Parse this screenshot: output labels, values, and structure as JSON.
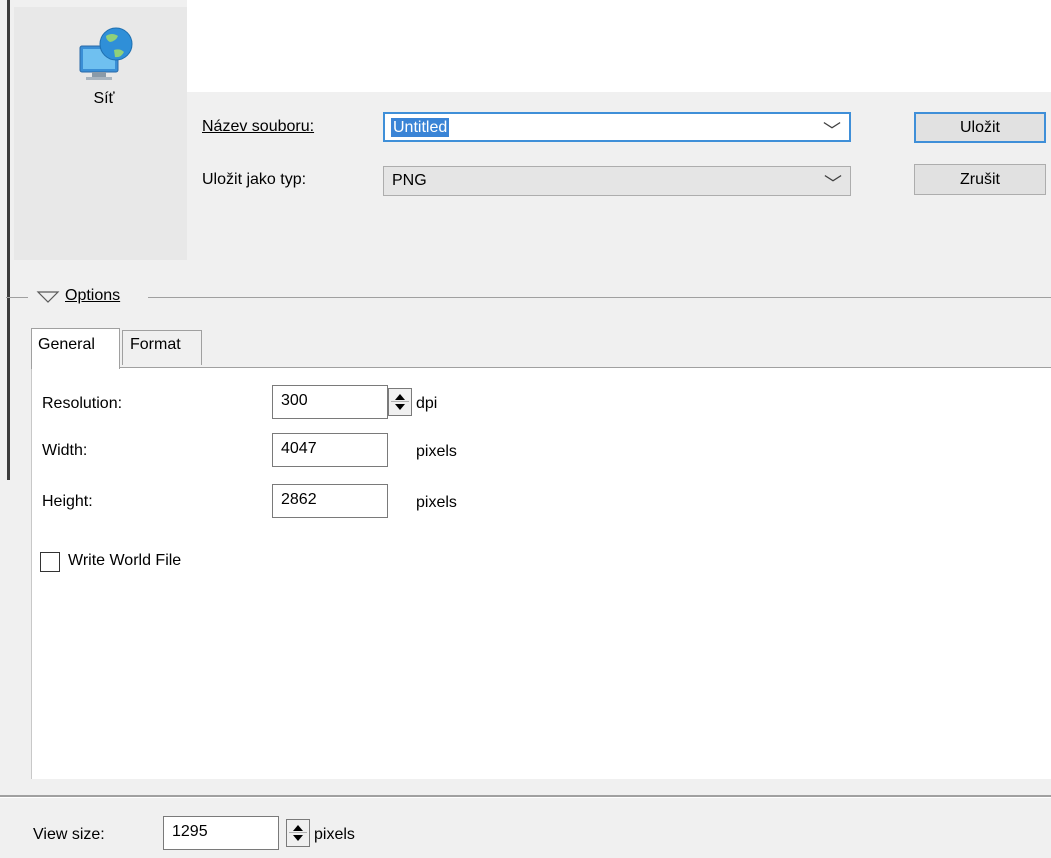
{
  "places": {
    "network_label": "Síť"
  },
  "file_name": {
    "label": "Název souboru:",
    "value": "Untitled"
  },
  "save_type": {
    "label": "Uložit jako typ:",
    "value": "PNG"
  },
  "buttons": {
    "save": "Uložit",
    "cancel": "Zrušit"
  },
  "options": {
    "label": "Options",
    "tabs": [
      "General",
      "Format"
    ],
    "active_tab": "General"
  },
  "general": {
    "resolution": {
      "label": "Resolution:",
      "value": "300",
      "unit": "dpi"
    },
    "width": {
      "label": "Width:",
      "value": "4047",
      "unit": "pixels"
    },
    "height": {
      "label": "Height:",
      "value": "2862",
      "unit": "pixels"
    },
    "world_file": {
      "label": "Write World File",
      "checked": false
    }
  },
  "view_size": {
    "label": "View size:",
    "value": "1295",
    "unit": "pixels"
  },
  "colors": {
    "focus_border": "#3f8fd8",
    "selection": "#3a84d6",
    "dialog_bg": "#f0f0f0"
  }
}
